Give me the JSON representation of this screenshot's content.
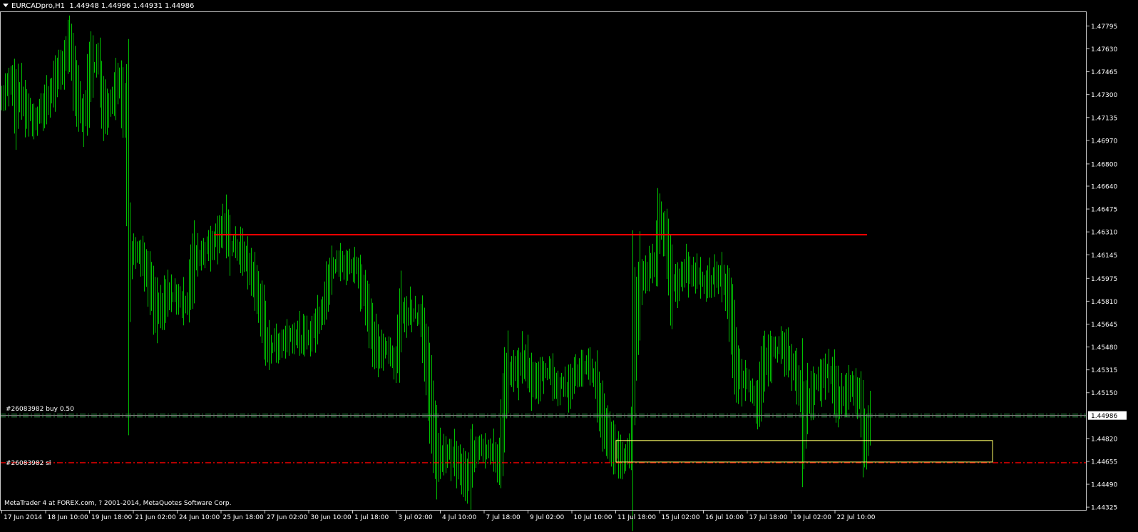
{
  "header": {
    "symbol_timeframe": "EURCADpro,H1",
    "ohlc": "1.44948 1.44996 1.44931 1.44986"
  },
  "copyright": "MetaTrader 4 at FOREX.com, ? 2001-2014, MetaQuotes Software Corp.",
  "orders": {
    "buy_label": "#26083982 buy 0.50",
    "sl_label": "#26083982 sl"
  },
  "colors": {
    "background": "#000000",
    "candles": "#00c000",
    "resistance_line": "#ff0000",
    "stop_loss_line": "#ff0000",
    "order_line": "#2f9e48",
    "zone_box": "#ffff66",
    "axis": "#c8c8c8",
    "current_price_bg": "#ffffff"
  },
  "chart_data": {
    "type": "line",
    "instrument": "EURCADpro",
    "timeframe": "H1",
    "current_price": 1.44986,
    "y_ticks": [
      1.47795,
      1.4763,
      1.47465,
      1.473,
      1.47135,
      1.4697,
      1.468,
      1.4664,
      1.46475,
      1.4631,
      1.46145,
      1.45975,
      1.4581,
      1.45645,
      1.4548,
      1.45315,
      1.4515,
      1.4482,
      1.44655,
      1.4449,
      1.44325
    ],
    "y_tick_labels": [
      "1.47795",
      "1.47630",
      "1.47465",
      "1.47300",
      "1.47135",
      "1.46970",
      "1.46800",
      "1.46640",
      "1.46475",
      "1.46310",
      "1.46145",
      "1.45975",
      "1.45810",
      "1.45645",
      "1.45480",
      "1.45315",
      "1.45150",
      "1.44820",
      "1.44655",
      "1.44490",
      "1.44325"
    ],
    "x_labels": [
      "17 Jun 2014",
      "18 Jun 10:00",
      "19 Jun 18:00",
      "21 Jun 02:00",
      "24 Jun 10:00",
      "25 Jun 18:00",
      "27 Jun 02:00",
      "30 Jun 10:00",
      "1 Jul 18:00",
      "3 Jul 02:00",
      "4 Jul 10:00",
      "7 Jul 18:00",
      "9 Jul 02:00",
      "10 Jul 10:00",
      "11 Jul 18:00",
      "15 Jul 02:00",
      "16 Jul 10:00",
      "17 Jul 18:00",
      "19 Jul 02:00",
      "22 Jul 10:00"
    ],
    "ylim": [
      1.443,
      1.479
    ],
    "series": [
      {
        "style": "high-low bars",
        "anchors": [
          [
            0,
            1.4725
          ],
          [
            8,
            1.4733
          ],
          [
            17,
            1.474
          ],
          [
            22,
            1.4722
          ],
          [
            26,
            1.4733
          ],
          [
            38,
            1.4718
          ],
          [
            50,
            1.471
          ],
          [
            60,
            1.472
          ],
          [
            75,
            1.4737
          ],
          [
            90,
            1.4755
          ],
          [
            98,
            1.4765
          ],
          [
            108,
            1.4728
          ],
          [
            118,
            1.471
          ],
          [
            128,
            1.4752
          ],
          [
            137,
            1.4753
          ],
          [
            146,
            1.4718
          ],
          [
            156,
            1.4725
          ],
          [
            166,
            1.4745
          ],
          [
            175,
            1.4715
          ],
          [
            178,
            1.468
          ],
          [
            180,
            1.4605
          ],
          [
            190,
            1.462
          ],
          [
            200,
            1.461
          ],
          [
            212,
            1.4588
          ],
          [
            220,
            1.457
          ],
          [
            235,
            1.4585
          ],
          [
            250,
            1.4585
          ],
          [
            262,
            1.4578
          ],
          [
            272,
            1.4612
          ],
          [
            285,
            1.4617
          ],
          [
            300,
            1.4625
          ],
          [
            314,
            1.4637
          ],
          [
            322,
            1.4622
          ],
          [
            336,
            1.4618
          ],
          [
            350,
            1.4605
          ],
          [
            362,
            1.4585
          ],
          [
            372,
            1.4555
          ],
          [
            380,
            1.4548
          ],
          [
            395,
            1.4552
          ],
          [
            410,
            1.4558
          ],
          [
            425,
            1.4553
          ],
          [
            440,
            1.456
          ],
          [
            455,
            1.458
          ],
          [
            465,
            1.4606
          ],
          [
            475,
            1.4608
          ],
          [
            488,
            1.4607
          ],
          [
            500,
            1.4605
          ],
          [
            512,
            1.4585
          ],
          [
            522,
            1.4555
          ],
          [
            532,
            1.4545
          ],
          [
            545,
            1.4545
          ],
          [
            555,
            1.4537
          ],
          [
            562,
            1.457
          ],
          [
            575,
            1.4575
          ],
          [
            590,
            1.457
          ],
          [
            600,
            1.4525
          ],
          [
            608,
            1.449
          ],
          [
            613,
            1.4465
          ],
          [
            622,
            1.4472
          ],
          [
            635,
            1.447
          ],
          [
            645,
            1.446
          ],
          [
            655,
            1.445
          ],
          [
            662,
            1.447
          ],
          [
            672,
            1.4478
          ],
          [
            682,
            1.4475
          ],
          [
            692,
            1.447
          ],
          [
            700,
            1.4465
          ],
          [
            706,
            1.4505
          ],
          [
            712,
            1.4527
          ],
          [
            724,
            1.453
          ],
          [
            736,
            1.454
          ],
          [
            748,
            1.452
          ],
          [
            760,
            1.453
          ],
          [
            772,
            1.453
          ],
          [
            782,
            1.452
          ],
          [
            795,
            1.452
          ],
          [
            810,
            1.453
          ],
          [
            825,
            1.4532
          ],
          [
            835,
            1.4525
          ],
          [
            845,
            1.4495
          ],
          [
            855,
            1.4483
          ],
          [
            862,
            1.4474
          ],
          [
            872,
            1.4468
          ],
          [
            884,
            1.447
          ],
          [
            888,
            1.4545
          ],
          [
            898,
            1.4595
          ],
          [
            910,
            1.4605
          ],
          [
            918,
            1.461
          ],
          [
            924,
            1.464
          ],
          [
            932,
            1.4628
          ],
          [
            942,
            1.459
          ],
          [
            952,
            1.4595
          ],
          [
            962,
            1.4605
          ],
          [
            975,
            1.46
          ],
          [
            987,
            1.4595
          ],
          [
            997,
            1.4595
          ],
          [
            1010,
            1.46
          ],
          [
            1018,
            1.459
          ],
          [
            1025,
            1.4565
          ],
          [
            1032,
            1.4535
          ],
          [
            1040,
            1.4525
          ],
          [
            1050,
            1.452
          ],
          [
            1062,
            1.451
          ],
          [
            1072,
            1.4535
          ],
          [
            1085,
            1.4545
          ],
          [
            1095,
            1.4548
          ],
          [
            1105,
            1.454
          ],
          [
            1115,
            1.453
          ],
          [
            1122,
            1.452
          ],
          [
            1126,
            1.4485
          ],
          [
            1132,
            1.451
          ],
          [
            1142,
            1.452
          ],
          [
            1152,
            1.4525
          ],
          [
            1165,
            1.453
          ],
          [
            1175,
            1.451
          ],
          [
            1185,
            1.4515
          ],
          [
            1198,
            1.452
          ],
          [
            1206,
            1.451
          ],
          [
            1210,
            1.449
          ],
          [
            1214,
            1.448
          ],
          [
            1220,
            1.4498
          ]
        ]
      }
    ],
    "lines": {
      "resistance": 1.4629,
      "order_buy": 1.44996,
      "order_buy_2": 1.44975,
      "stop_loss": 1.44645,
      "zone_top": 1.44805,
      "zone_bottom": 1.4465
    },
    "grid": false,
    "legend": "none"
  }
}
